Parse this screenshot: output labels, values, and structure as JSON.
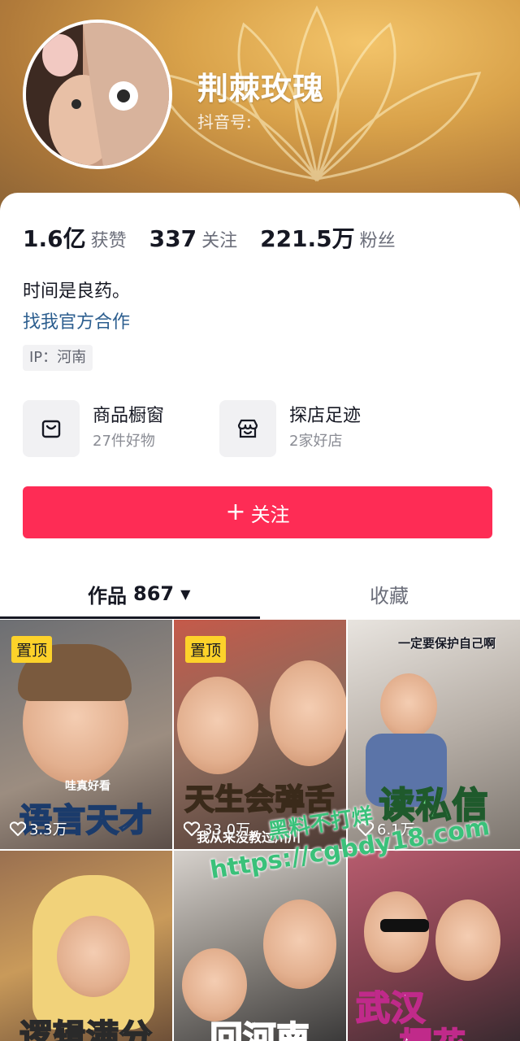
{
  "profile": {
    "nickname": "荆棘玫瑰",
    "douyin_id_label": "抖音号:",
    "stats": [
      {
        "value": "1.6亿",
        "label": "获赞"
      },
      {
        "value": "337",
        "label": "关注"
      },
      {
        "value": "221.5万",
        "label": "粉丝"
      }
    ],
    "bio": "时间是良药。",
    "coop_link": "找我官方合作",
    "ip": "IP：河南"
  },
  "features": [
    {
      "title": "商品橱窗",
      "sub": "27件好物",
      "icon": "shopping-bag-icon"
    },
    {
      "title": "探店足迹",
      "sub": "2家好店",
      "icon": "shop-icon"
    }
  ],
  "follow_button": {
    "plus": "+",
    "label": "关注"
  },
  "tabs": {
    "works_label": "作品",
    "works_count": "867",
    "works_caret": "▼",
    "favorites_label": "收藏"
  },
  "videos": [
    {
      "pinned": "置顶",
      "top_caption": "哇真好看",
      "caption": "语言天才",
      "likes": "3.3万"
    },
    {
      "pinned": "置顶",
      "caption": "天生会弹舌",
      "sub_caption": "我从来没教过川川",
      "likes": "33.0万"
    },
    {
      "top_caption": "一定要保护自己啊",
      "caption": "读私信",
      "likes": "6.1万"
    },
    {
      "caption": "逻辑满分"
    },
    {
      "caption": "回河南"
    },
    {
      "caption": "武汉",
      "caption2": "樱花"
    }
  ],
  "watermark": {
    "line1": "黑料不打烊",
    "line2": "https://cgbdy18.com"
  },
  "colors": {
    "accent": "#fe2c55",
    "link": "#2c5e8f",
    "pin": "#fdd22a"
  }
}
